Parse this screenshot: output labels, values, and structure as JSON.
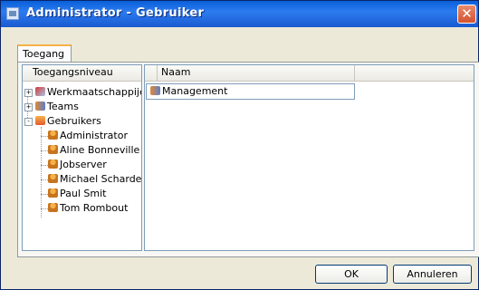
{
  "window": {
    "title": "Administrator - Gebruiker",
    "close_icon": "close-icon"
  },
  "tabs": [
    {
      "label": "Toegang"
    }
  ],
  "tree": {
    "header": "Toegangsniveau",
    "items": [
      {
        "label": "Werkmaatschappijen",
        "icon": "company-icon",
        "expander": "+"
      },
      {
        "label": "Teams",
        "icon": "team-icon",
        "expander": "+"
      },
      {
        "label": "Gebruikers",
        "icon": "users-icon",
        "expander": "-",
        "children": [
          {
            "label": "Administrator",
            "icon": "user-icon"
          },
          {
            "label": "Aline Bonneville",
            "icon": "user-icon"
          },
          {
            "label": "Jobserver",
            "icon": "user-icon"
          },
          {
            "label": "Michael Schardein",
            "icon": "user-icon"
          },
          {
            "label": "Paul Smit",
            "icon": "user-icon"
          },
          {
            "label": "Tom Rombout",
            "icon": "user-icon"
          }
        ]
      }
    ]
  },
  "table": {
    "columns": [
      "Naam"
    ],
    "rows": [
      {
        "name": "Management",
        "icon": "team-icon"
      }
    ]
  },
  "buttons": {
    "ok": "OK",
    "cancel": "Annuleren"
  }
}
